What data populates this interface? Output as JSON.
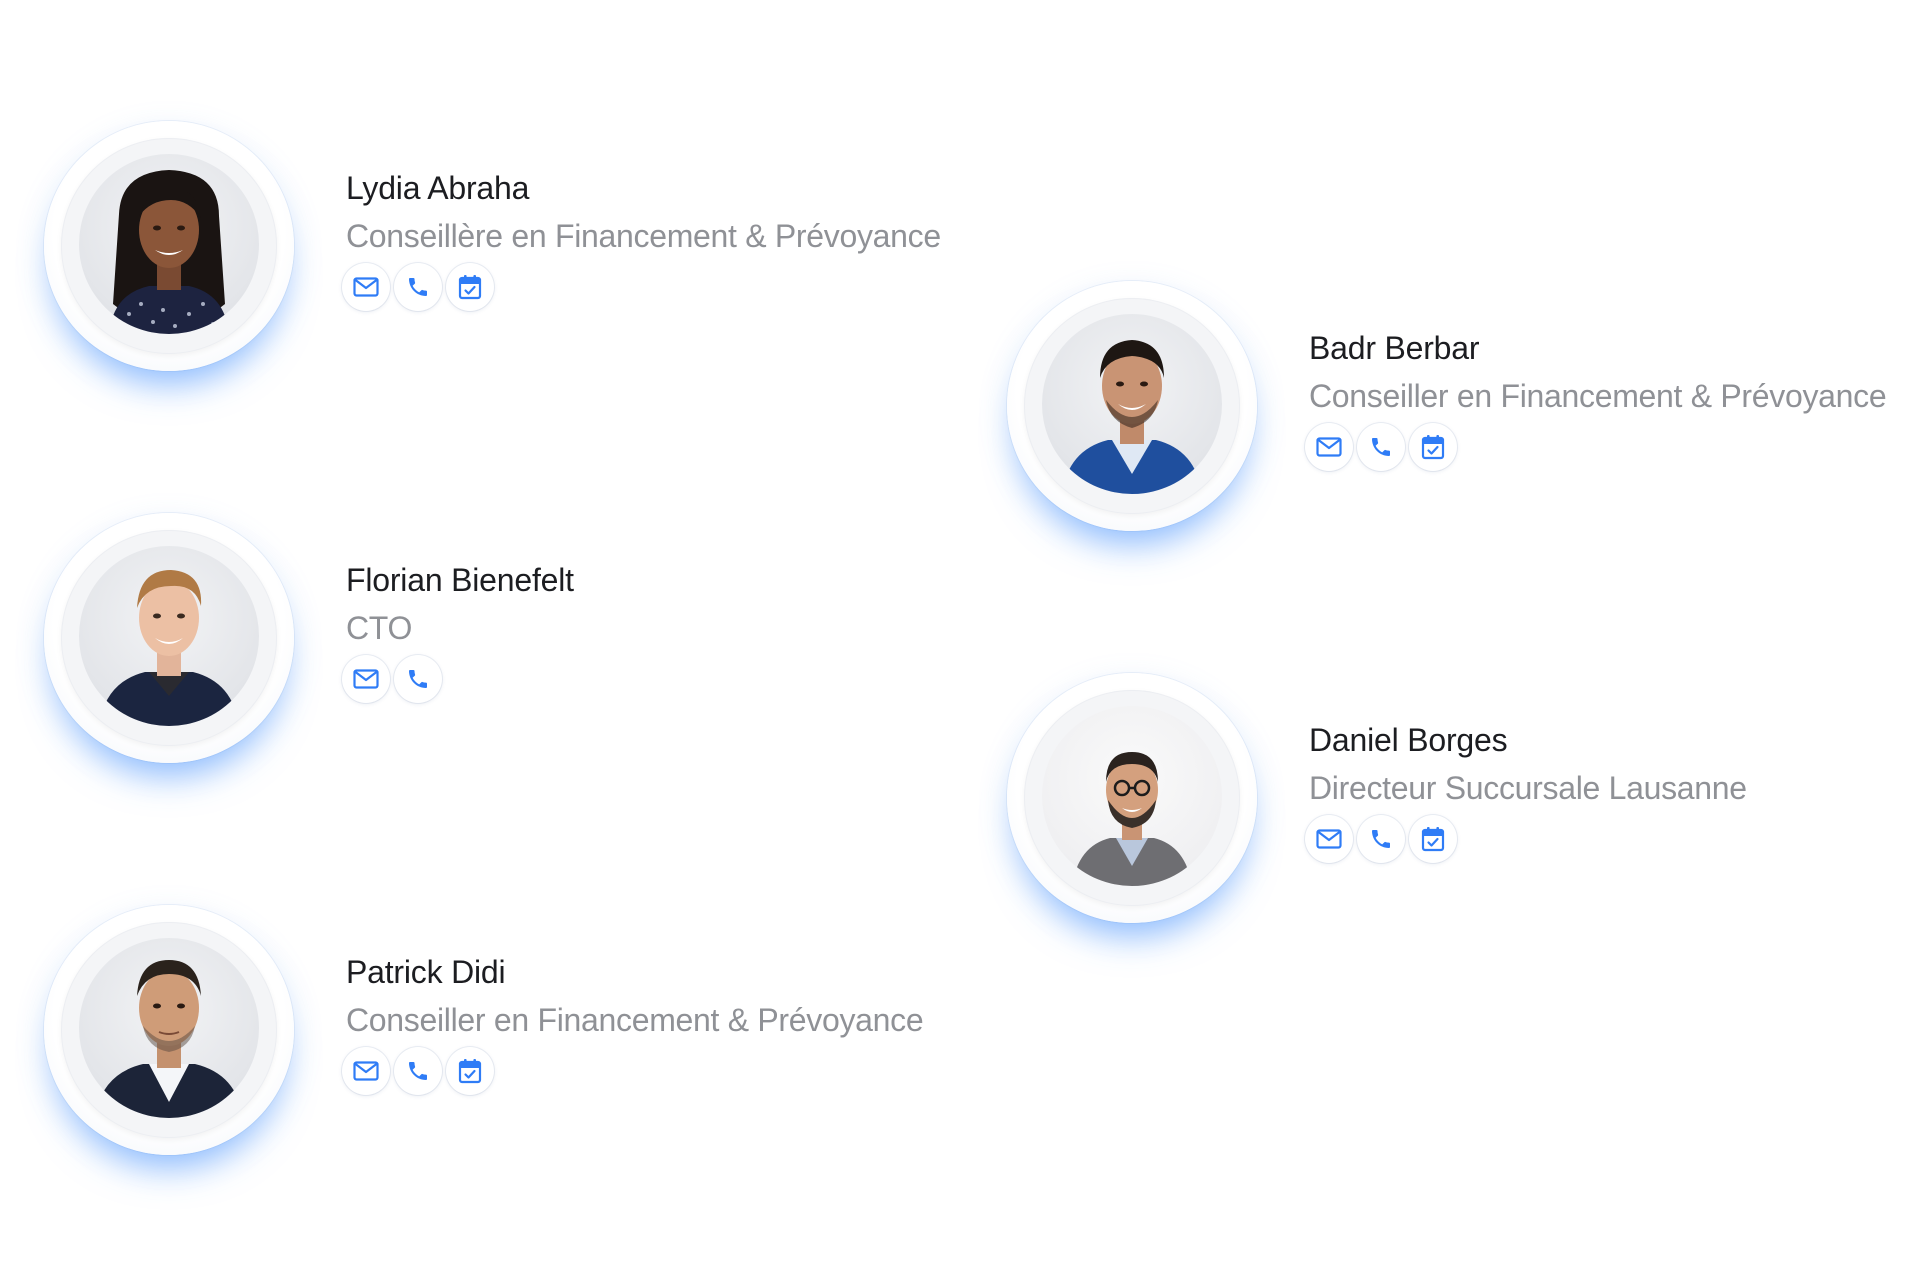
{
  "accent_color": "#2f7cf6",
  "team": [
    {
      "name": "Lydia Abraha",
      "role": "Conseillère en Financement & Prévoyance",
      "actions": [
        "mail-icon",
        "phone-icon",
        "calendar-icon"
      ]
    },
    {
      "name": "Badr Berbar",
      "role": "Conseiller en Financement & Prévoyance",
      "actions": [
        "mail-icon",
        "phone-icon",
        "calendar-icon"
      ]
    },
    {
      "name": "Florian Bienefelt",
      "role": "CTO",
      "actions": [
        "mail-icon",
        "phone-icon"
      ]
    },
    {
      "name": "Daniel Borges",
      "role": "Directeur Succursale Lausanne",
      "actions": [
        "mail-icon",
        "phone-icon",
        "calendar-icon"
      ]
    },
    {
      "name": "Patrick Didi",
      "role": "Conseiller en Financement & Prévoyance",
      "actions": [
        "mail-icon",
        "phone-icon",
        "calendar-icon"
      ]
    }
  ]
}
